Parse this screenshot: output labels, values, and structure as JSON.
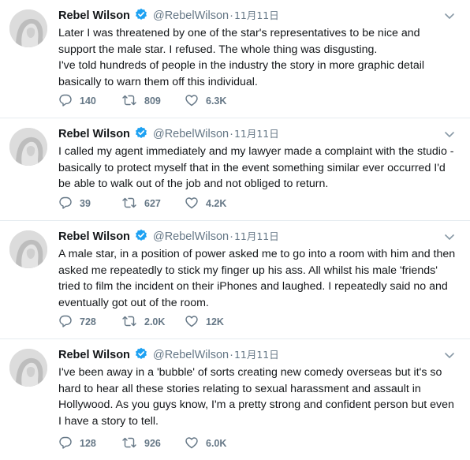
{
  "colors": {
    "brand_blue": "#1da1f2",
    "muted": "#657786",
    "text": "#14171a",
    "divider": "#e6ecf0"
  },
  "icons": {
    "verified": "verified-badge-icon",
    "menu": "chevron-down-icon",
    "reply": "reply-icon",
    "retweet": "retweet-icon",
    "like": "heart-icon"
  },
  "tweets": [
    {
      "name": "Rebel Wilson",
      "handle": "@RebelWilson",
      "separator": "·",
      "time": "11月11日",
      "text": "Later I was threatened by one of the star's representatives to be nice and support the male star. I refused. The whole thing was disgusting.\nI've told hundreds of people in the industry the story in more graphic detail basically to warn them off this individual.",
      "replies": "140",
      "retweets": "809",
      "likes": "6.3K"
    },
    {
      "name": "Rebel Wilson",
      "handle": "@RebelWilson",
      "separator": "·",
      "time": "11月11日",
      "text": "I called my agent immediately and my lawyer made a complaint with the studio - basically to protect myself that in the event something similar ever occurred I'd be able to walk out of the job and not obliged to return.",
      "replies": "39",
      "retweets": "627",
      "likes": "4.2K"
    },
    {
      "name": "Rebel Wilson",
      "handle": "@RebelWilson",
      "separator": "·",
      "time": "11月11日",
      "text": "A male star, in a position of power asked me to go into a room with him and then asked me repeatedly to stick my finger up his ass. All whilst his male 'friends' tried to film the incident on their iPhones and laughed. I repeatedly said no and eventually got out of the room.",
      "replies": "728",
      "retweets": "2.0K",
      "likes": "12K"
    },
    {
      "name": "Rebel Wilson",
      "handle": "@RebelWilson",
      "separator": "·",
      "time": "11月11日",
      "text": "I've been away in a 'bubble' of sorts creating new comedy overseas but it's so hard to hear all these stories relating to sexual harassment and assault in Hollywood. As you guys know, I'm a pretty strong and confident person but even I have a story to tell.",
      "replies": "128",
      "retweets": "926",
      "likes": "6.0K"
    }
  ]
}
